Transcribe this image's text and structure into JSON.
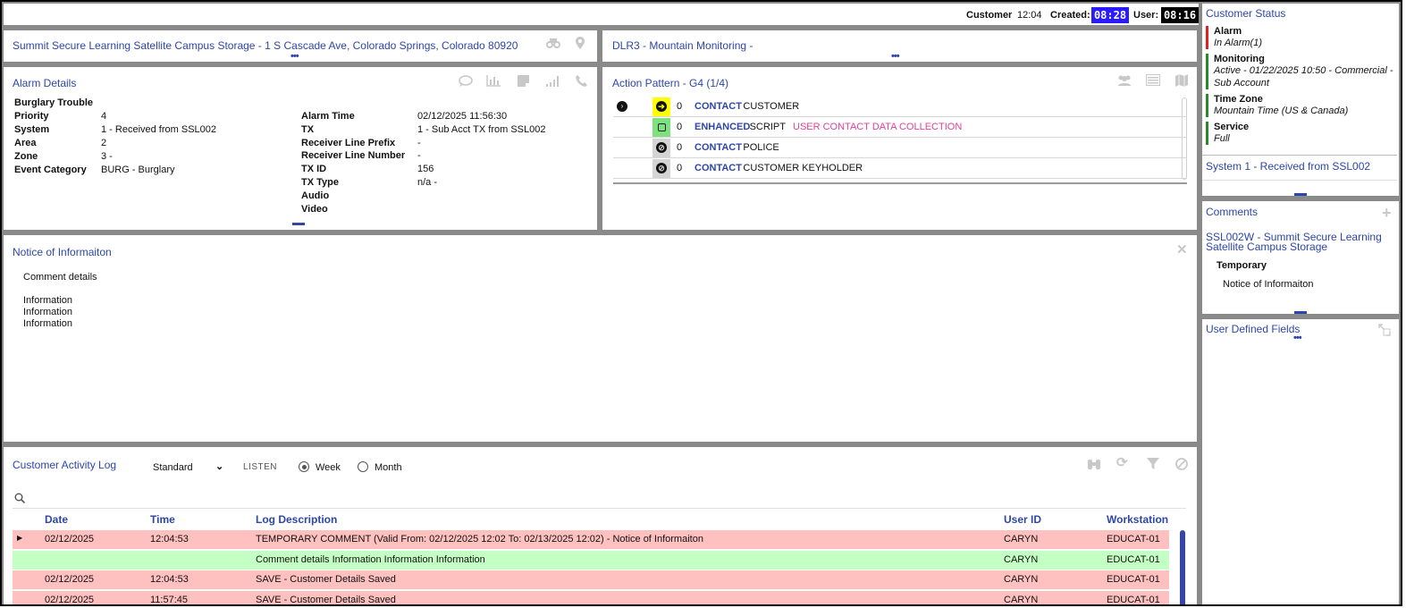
{
  "topbar": {
    "customer_label": "Customer",
    "customer_time": "12:04",
    "created_label": "Created:",
    "created_clock": "08:28",
    "user_label": "User:",
    "user_clock": "08:16",
    "created_color": "#2a1cff",
    "user_color": "#000000"
  },
  "site": {
    "title": "Summit Secure Learning Satellite Campus Storage - 1 S Cascade Ave, Colorado Springs, Colorado 80920",
    "icons": [
      "binoculars-icon",
      "location-pin-icon"
    ]
  },
  "dealer": {
    "title": "DLR3 - Mountain Monitoring -"
  },
  "alarm_details": {
    "title": "Alarm Details",
    "event": "Burglary Trouble",
    "left": [
      {
        "label": "Priority",
        "value": "4"
      },
      {
        "label": "System",
        "value": "1 - Received from SSL002"
      },
      {
        "label": "Area",
        "value": "2"
      },
      {
        "label": "Zone",
        "value": "3 -"
      },
      {
        "label": "Event Category",
        "value": "BURG - Burglary"
      }
    ],
    "right": [
      {
        "label": "Alarm Time",
        "value": "02/12/2025 11:56:30"
      },
      {
        "label": "TX",
        "value": "1 - Sub Acct TX from SSL002"
      },
      {
        "label": "Receiver Line Prefix",
        "value": "-"
      },
      {
        "label": "Receiver Line Number",
        "value": "-"
      },
      {
        "label": "TX ID",
        "value": "156"
      },
      {
        "label": "TX Type",
        "value": "n/a -"
      },
      {
        "label": "Audio",
        "value": ""
      },
      {
        "label": "Video",
        "value": ""
      }
    ]
  },
  "action_pattern": {
    "title": "Action Pattern - G4 (1/4)",
    "rows": [
      {
        "status": "current",
        "box_color": "#ffff00",
        "box_icon": "arrow-right-icon",
        "count": "0",
        "key": "CONTACT",
        "text": "CUSTOMER",
        "extra": ""
      },
      {
        "status": "",
        "box_color": "#7ee07e",
        "box_icon": "square-icon",
        "count": "0",
        "key": "ENHANCED",
        "text": "SCRIPT",
        "extra": "USER CONTACT DATA COLLECTION"
      },
      {
        "status": "",
        "box_color": "#d4d4d4",
        "box_icon": "blocked-icon",
        "count": "0",
        "key": "CONTACT",
        "text": "POLICE",
        "extra": ""
      },
      {
        "status": "",
        "box_color": "#d4d4d4",
        "box_icon": "blocked-icon",
        "count": "0",
        "key": "CONTACT",
        "text": "CUSTOMER KEYHOLDER",
        "extra": ""
      }
    ]
  },
  "notice": {
    "title": "Notice of Informaiton",
    "lines": [
      "Comment details",
      "",
      "Information",
      "Information",
      "Information"
    ]
  },
  "activity_log": {
    "title": "Customer Activity Log",
    "view_select": "Standard",
    "listen_label": "LISTEN",
    "range_options": [
      {
        "label": "Week",
        "selected": true
      },
      {
        "label": "Month",
        "selected": false
      }
    ],
    "columns": [
      "Date",
      "Time",
      "Log Description",
      "User ID",
      "Workstation"
    ],
    "rows": [
      {
        "expander": true,
        "color": "#ffc0c0",
        "date": "02/12/2025",
        "time": "12:04:53",
        "desc": "TEMPORARY COMMENT (Valid From: 02/12/2025 12:02 To: 02/13/2025 12:02) - Notice of Informaiton",
        "user": "CARYN",
        "ws": "EDUCAT-01"
      },
      {
        "expander": false,
        "color": "#c4ffc4",
        "date": "",
        "time": "",
        "desc": "Comment details Information Information Information",
        "user": "CARYN",
        "ws": "EDUCAT-01"
      },
      {
        "expander": false,
        "color": "#ffc0c0",
        "date": "02/12/2025",
        "time": "12:04:53",
        "desc": "SAVE - Customer Details Saved",
        "user": "CARYN",
        "ws": "EDUCAT-01"
      },
      {
        "expander": false,
        "color": "#ffc0c0",
        "date": "02/12/2025",
        "time": "11:57:45",
        "desc": "SAVE - Customer Details Saved",
        "user": "CARYN",
        "ws": "EDUCAT-01"
      }
    ]
  },
  "customer_status": {
    "title": "Customer Status",
    "items": [
      {
        "key": "Alarm",
        "value": "In Alarm(1)",
        "color": "#e02020"
      },
      {
        "key": "Monitoring",
        "value": "Active - 01/22/2025 10:50 - Commercial - Sub Account",
        "color": "#2a8a2a"
      },
      {
        "key": "Time Zone",
        "value": "Mountain Time (US & Canada)",
        "color": "#2a8a2a"
      },
      {
        "key": "Service",
        "value": "Full",
        "color": "#2a8a2a"
      }
    ],
    "system_link": "System 1 - Received from SSL002"
  },
  "comments": {
    "title": "Comments",
    "account": "SSL002W - Summit Secure Learning Satellite Campus Storage",
    "type": "Temporary",
    "text": "Notice of Informaiton"
  },
  "udf": {
    "title": "User Defined Fields"
  }
}
